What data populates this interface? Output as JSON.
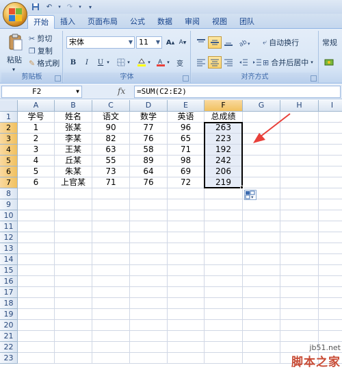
{
  "tabs": [
    "开始",
    "插入",
    "页面布局",
    "公式",
    "数据",
    "审阅",
    "视图",
    "团队"
  ],
  "active_tab": 0,
  "ribbon": {
    "clipboard": {
      "label": "剪贴板",
      "paste": "粘贴",
      "cut": "剪切",
      "copy": "复制",
      "format_painter": "格式刷"
    },
    "font": {
      "label": "字体",
      "font_name": "宋体",
      "font_size": "11",
      "bold": "B",
      "italic": "I",
      "underline": "U",
      "grow": "A",
      "shrink": "A",
      "phonetic": "变"
    },
    "alignment": {
      "label": "对齐方式",
      "wrap_text": "自动换行",
      "merge_center": "合并后居中"
    },
    "number": {
      "format": "常规"
    }
  },
  "formula_bar": {
    "name_box": "F2",
    "fx": "fx",
    "formula": "=SUM(C2:E2)"
  },
  "columns": [
    "A",
    "B",
    "C",
    "D",
    "E",
    "F",
    "G",
    "H",
    "I"
  ],
  "rows": [
    "1",
    "2",
    "3",
    "4",
    "5",
    "6",
    "7",
    "8",
    "9",
    "10",
    "11",
    "12",
    "13",
    "14",
    "15",
    "16",
    "17",
    "18",
    "19",
    "20",
    "21",
    "22",
    "23"
  ],
  "sheet": {
    "headers": [
      "学号",
      "姓名",
      "语文",
      "数学",
      "英语",
      "总成绩"
    ],
    "records": [
      [
        "1",
        "张某",
        "90",
        "77",
        "96",
        "263"
      ],
      [
        "2",
        "李某",
        "82",
        "76",
        "65",
        "223"
      ],
      [
        "3",
        "王某",
        "63",
        "58",
        "71",
        "192"
      ],
      [
        "4",
        "丘某",
        "55",
        "89",
        "98",
        "242"
      ],
      [
        "5",
        "朱某",
        "73",
        "64",
        "69",
        "206"
      ],
      [
        "6",
        "上官某",
        "71",
        "76",
        "72",
        "219"
      ]
    ]
  },
  "selection": "F2:F7",
  "colors": {
    "selection_header": "#f1c15f",
    "arrow": "#e8403a",
    "range_fill": "#e6ecf7"
  },
  "watermark": {
    "url": "jb51.net",
    "name": "脚本之家"
  }
}
